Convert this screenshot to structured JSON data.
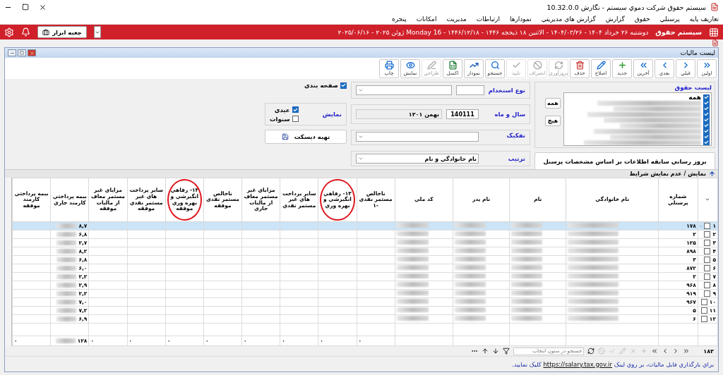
{
  "app_title": "سيستم حقوق شرکت دموي سيستم - نگارش 10.32.0.0",
  "menu": [
    "تعاريف پايه",
    "پرسنلي",
    "حقوق",
    "گزارش",
    "گزارش هاي مديريتي",
    "نمودارها",
    "ارتباطات",
    "مديريت",
    "امکانات",
    "پنجره"
  ],
  "header_bar": {
    "system_name": "سيستم حقوق",
    "date": "دوشنبه ۲۶ خرداد ۱۴۰۴ - ۱۴۰۴/۰۳/۲۶ - الاثنين ۱۸ ذيحجه ۱۴۴۶ - ۱۴۴۶/۱۲/۱۸ - Monday 16 ژوئن ۲۰۲۵ - ۲۰۲۵/۰۶/۱۶",
    "toolbox": "جعبه ابزار"
  },
  "window": {
    "title": "ليست ماليات"
  },
  "toolbar": [
    {
      "kind": "first",
      "label": "اولين",
      "disabled": false
    },
    {
      "kind": "prev",
      "label": "قبلي",
      "disabled": false
    },
    {
      "kind": "next",
      "label": "بعدي",
      "disabled": false
    },
    {
      "kind": "last",
      "label": "آخرين",
      "disabled": false
    },
    {
      "kind": "new",
      "label": "جديد",
      "disabled": false
    },
    {
      "kind": "edit",
      "label": "اصلاح",
      "disabled": false
    },
    {
      "kind": "delete",
      "label": "حذف",
      "disabled": false
    },
    {
      "kind": "refresh",
      "label": "بروزآوري",
      "disabled": true
    },
    {
      "kind": "cancel",
      "label": "انصراف",
      "disabled": true
    },
    {
      "kind": "confirm",
      "label": "تاييد",
      "disabled": true
    },
    {
      "kind": "search",
      "label": "جستجو",
      "disabled": false
    },
    {
      "kind": "chart",
      "label": "نمودار",
      "disabled": false
    },
    {
      "kind": "excel",
      "label": "اکسل",
      "disabled": false
    },
    {
      "kind": "design",
      "label": "طراحي",
      "disabled": true
    },
    {
      "kind": "view",
      "label": "نمايش",
      "disabled": false
    },
    {
      "kind": "print",
      "label": "چاپ",
      "disabled": false
    }
  ],
  "salary_list": {
    "title": "ليست حقوق",
    "items": [
      {
        "label": "همه",
        "checked": true
      },
      {
        "checked": true
      },
      {
        "checked": true
      },
      {
        "checked": true
      },
      {
        "checked": true
      },
      {
        "checked": true
      },
      {
        "checked": true
      },
      {
        "checked": true
      },
      {
        "checked": true
      }
    ],
    "all_button": "همه",
    "none_button": "هيچ"
  },
  "update_button": "بروز رساني سابقه اطلاعات بر اساس مشخصات پرسنل",
  "employment_type": {
    "label": "نوع استخدام"
  },
  "year_month": {
    "label": "سال و ماه",
    "code": "140111",
    "month": "بهمن ۱۲۰۱"
  },
  "breakdown": {
    "label": "تفکيک"
  },
  "order": {
    "label": "ترتيب",
    "value": "نام خانوادگي و نام"
  },
  "pagination": {
    "label": "صفحه بندي",
    "checked": true
  },
  "display": {
    "label": "نمايش",
    "options": [
      {
        "label": "عيدي",
        "checked": true
      },
      {
        "label": "سنوات",
        "checked": false
      }
    ]
  },
  "disk_button": "تهيه ديسکت",
  "conditions_bar": "نمايش / عدم نمايش شرايط",
  "columns": [
    {
      "kind": "select"
    },
    {
      "kind": "personnel",
      "label": "شماره پرسنلي"
    },
    {
      "kind": "blurred",
      "label": "نام خانوادگي"
    },
    {
      "kind": "blurred",
      "label": "نام"
    },
    {
      "kind": "blurred",
      "label": "نام پدر"
    },
    {
      "kind": "blurred",
      "label": "کد ملي"
    },
    {
      "kind": "amount",
      "label": "ناخالص مستمر نقدي -۱"
    },
    {
      "kind": "amount",
      "label": "۱۳- رفاهي انگيرشي و بهره وري",
      "highlighted": true
    },
    {
      "kind": "amount",
      "label": "ساير پرداخت هاي غير مستمر نقدي"
    },
    {
      "kind": "amount",
      "label": "مزاياي غير مستمر معاف از ماليات جاري"
    },
    {
      "kind": "amount",
      "label": "ناخالص مستمر نقدي موفقه"
    },
    {
      "kind": "amount",
      "label": "۱۳- رفاهي انگيرشي و بهره وري موفقه",
      "highlighted": true
    },
    {
      "kind": "amount",
      "label": "ساير پرداخت هاي غير مستمر نقدي موفقه"
    },
    {
      "kind": "amount",
      "label": "مزاياي غير مستمر معاف از ماليات موفقه"
    },
    {
      "kind": "insurance",
      "label": "بيمه پرداختي کارمند جاري"
    },
    {
      "kind": "amount",
      "label": "بيمه پرداختي کارمند موفقه"
    }
  ],
  "rows": [
    {
      "number": "۱",
      "checked": false,
      "selected": true,
      "personnel_no": "۱۷۸",
      "insurance": "۸,۷"
    },
    {
      "number": "۲",
      "checked": false,
      "selected": false,
      "personnel_no": "۲",
      "insurance": "۶,۸"
    },
    {
      "number": "۳",
      "checked": false,
      "selected": false,
      "personnel_no": "۱۲۵",
      "insurance": "۲,۷"
    },
    {
      "number": "۴",
      "checked": false,
      "selected": false,
      "personnel_no": "۸۹۸",
      "insurance": "۸,۲"
    },
    {
      "number": "۵",
      "checked": false,
      "selected": false,
      "personnel_no": "۳",
      "insurance": "۶,۸"
    },
    {
      "number": "۶",
      "checked": false,
      "selected": false,
      "personnel_no": "۸۷۲",
      "insurance": "۶,۰"
    },
    {
      "number": "۷",
      "checked": false,
      "selected": false,
      "personnel_no": "۲",
      "insurance": "۲,۲"
    },
    {
      "number": "۸",
      "checked": false,
      "selected": false,
      "personnel_no": "۹۶۸",
      "insurance": "۲,۹"
    },
    {
      "number": "۹",
      "checked": false,
      "selected": false,
      "personnel_no": "۹۱۹",
      "insurance": "۲,۲"
    },
    {
      "number": "۱۰",
      "checked": false,
      "selected": false,
      "personnel_no": "۹۶۷",
      "insurance": "۷,۰"
    },
    {
      "number": "۱۱",
      "checked": false,
      "selected": false,
      "personnel_no": "۵",
      "insurance": "۷,۲"
    },
    {
      "number": "۱۲",
      "checked": false,
      "selected": false,
      "personnel_no": "۶",
      "insurance": "۶,۹"
    }
  ],
  "totals": [
    "۰",
    "۰",
    "۰",
    "۰",
    "۰",
    "۰",
    "۰",
    "۰",
    "۱۲۸",
    "۰"
  ],
  "footer_nav": {
    "count": "۱۸۲",
    "search_placeholder": "جستجو در ستون انتخاب"
  },
  "footer_message": {
    "before": "براي بارگذاري فايل ماليات، بر روي لينک",
    "link": "https://salary.tax.gov.ir",
    "after": "کليک نماييد."
  }
}
